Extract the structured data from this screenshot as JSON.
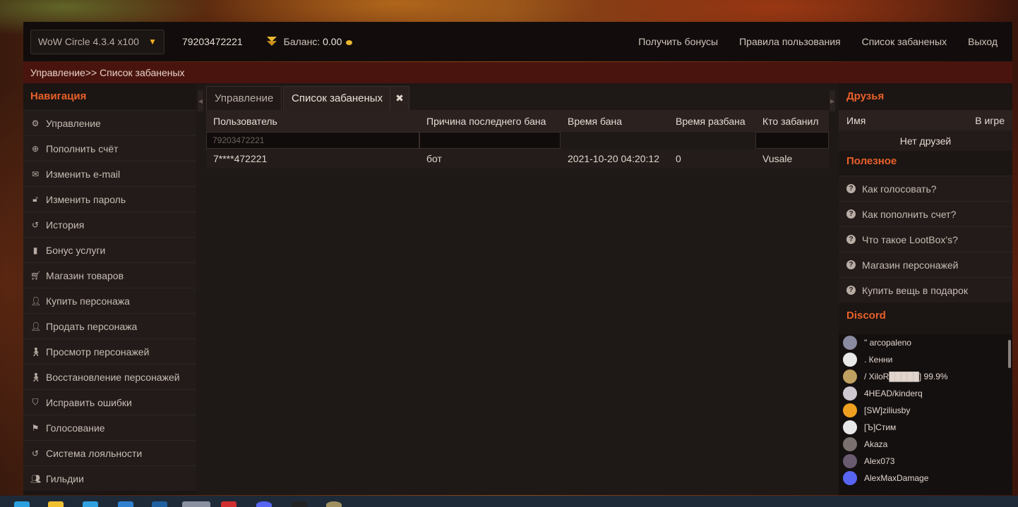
{
  "topbar": {
    "server": "WoW Circle 4.3.4 x100",
    "account": "79203472221",
    "balance_label": "Баланс:",
    "balance_value": "0.00",
    "nav": [
      "Получить бонусы",
      "Правила пользования",
      "Список забаненых",
      "Выход"
    ]
  },
  "breadcrumb": "Управление>> Список забаненых",
  "sidebar": {
    "title": "Навигация",
    "items": [
      {
        "label": "Управление",
        "icon": "gear-icon"
      },
      {
        "label": "Пополнить счёт",
        "icon": "plus-circle-icon"
      },
      {
        "label": "Изменить e-mail",
        "icon": "envelope-icon"
      },
      {
        "label": "Изменить пароль",
        "icon": "lock-icon"
      },
      {
        "label": "История",
        "icon": "history-icon"
      },
      {
        "label": "Бонус услуги",
        "icon": "bonus-icon"
      },
      {
        "label": "Магазин товаров",
        "icon": "cart-icon"
      },
      {
        "label": "Купить персонажа",
        "icon": "user-icon"
      },
      {
        "label": "Продать персонажа",
        "icon": "user-icon"
      },
      {
        "label": "Просмотр персонажей",
        "icon": "person-icon"
      },
      {
        "label": "Восстановление персонажей",
        "icon": "person-icon"
      },
      {
        "label": "Исправить ошибки",
        "icon": "shield-icon"
      },
      {
        "label": "Голосование",
        "icon": "flag-icon"
      },
      {
        "label": "Система лояльности",
        "icon": "history-icon"
      },
      {
        "label": "Гильдии",
        "icon": "users-icon"
      }
    ]
  },
  "tabs": {
    "first": "Управление",
    "active": "Список забаненых"
  },
  "table": {
    "headers": [
      "Пользователь",
      "Причина последнего бана",
      "Время бана",
      "Время разбана",
      "Кто забанил"
    ],
    "filter_user_placeholder": "79203472221",
    "rows": [
      {
        "user": "7****472221",
        "reason": "бот",
        "ban_time": "2021-10-20 04:20:12",
        "unban_time": "0",
        "banned_by": "Vusale"
      }
    ]
  },
  "friends": {
    "title": "Друзья",
    "col_name": "Имя",
    "col_ingame": "В игре",
    "empty": "Нет друзей"
  },
  "useful": {
    "title": "Полезное",
    "items": [
      "Как голосовать?",
      "Как пополнить счет?",
      "Что такое LootBox's?",
      "Магазин персонажей",
      "Купить вещь в подарок"
    ]
  },
  "discord": {
    "title": "Discord",
    "members": [
      {
        "name": "\" arcopaleno",
        "color": "#8a8aa0"
      },
      {
        "name": ". Кенни",
        "color": "#e8e8e8"
      },
      {
        "name": "/ XiloR█████] 99.9%",
        "color": "#c0a060"
      },
      {
        "name": "4HEAD/kinderq",
        "color": "#d0c8d0"
      },
      {
        "name": "[SW]ziliusby",
        "color": "#f0a020"
      },
      {
        "name": "[Ъ]Стим",
        "color": "#e8e8e8"
      },
      {
        "name": "Akaza",
        "color": "#7a7070"
      },
      {
        "name": "Alex073",
        "color": "#6a5a70"
      },
      {
        "name": "AlexMaxDamage",
        "color": "#5865f2"
      }
    ]
  }
}
